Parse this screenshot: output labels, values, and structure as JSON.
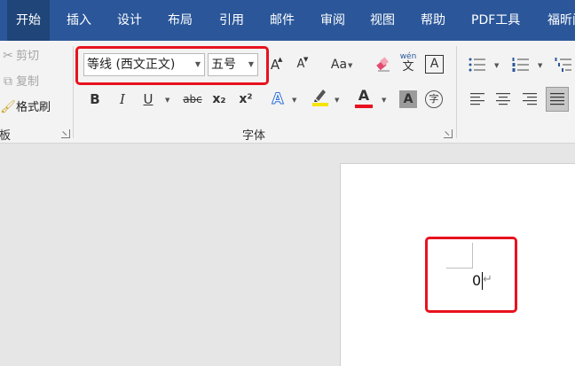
{
  "tabs": [
    {
      "label": "开始"
    },
    {
      "label": "插入"
    },
    {
      "label": "设计"
    },
    {
      "label": "布局"
    },
    {
      "label": "引用"
    },
    {
      "label": "邮件"
    },
    {
      "label": "审阅"
    },
    {
      "label": "视图"
    },
    {
      "label": "帮助"
    },
    {
      "label": "PDF工具"
    },
    {
      "label": "福昕阅"
    }
  ],
  "clipboard": {
    "cut": "剪切",
    "copy": "复制",
    "format_painter": "格式刷",
    "group_label": "占板"
  },
  "font": {
    "font_name": "等线 (西文正文)",
    "font_size": "五号",
    "group_label": "字体",
    "grow": "A",
    "shrink": "A",
    "change_case": "Aa",
    "phonetic_top": "wén",
    "phonetic_bottom": "文",
    "border_char": "A",
    "bold": "B",
    "italic": "I",
    "underline": "U",
    "strike": "abc",
    "subscript": "x₂",
    "superscript": "x²",
    "text_effects": "A",
    "font_color": "A",
    "char_shading": "A",
    "enclose": "字"
  },
  "colors": {
    "tabbar": "#2b579a",
    "highlight": "#f5e400",
    "font_color": "#e8121e",
    "annotation": "#e8121e"
  },
  "document": {
    "text": "0",
    "paragraph_mark": "↵"
  }
}
